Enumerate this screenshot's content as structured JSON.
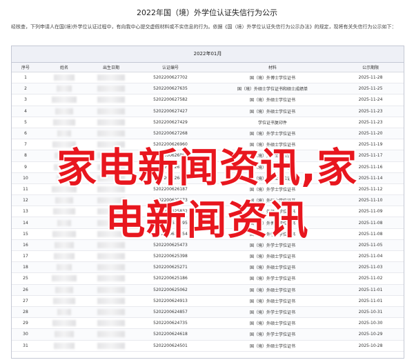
{
  "document": {
    "title": "2022年国（境）外学位认证失信行为公示",
    "intro": "经核查，下列申请人在国(境)外学位认证过程中，有向我中心提交虚假材料或不实信息的行为。依据《国（境）外学位认证失信行为公示办法》的规定，现将有关失信行为公示如下：",
    "table_caption": "2022年01月",
    "headers": [
      "序号",
      "姓名",
      "出生日期",
      "认证编号",
      "材料",
      "公示期限"
    ]
  },
  "rows": [
    {
      "seq": "1",
      "cert": "5202200627702",
      "material": "国（境）外博士学位证书",
      "deadline": "2025-11-28"
    },
    {
      "seq": "2",
      "cert": "5202200627635",
      "material": "国（境）外硕士学位证书和硕士成绩单",
      "deadline": "2025-11-25"
    },
    {
      "seq": "3",
      "cert": "5202200627582",
      "material": "国（境）外硕士学位证书",
      "deadline": "2025-11-24"
    },
    {
      "seq": "4",
      "cert": "5202200627427",
      "material": "国（境）外硕士学位证书",
      "deadline": "2025-11-23"
    },
    {
      "seq": "5",
      "cert": "5202200627429",
      "material": "学位证书复印件",
      "deadline": "2025-11-23"
    },
    {
      "seq": "6",
      "cert": "5202200627268",
      "material": "国（境）外学士学位证书",
      "deadline": "2025-11-20"
    },
    {
      "seq": "7",
      "cert": "5202200626960",
      "material": "国（境）外硕士学位证书",
      "deadline": "2025-11-19"
    },
    {
      "seq": "8",
      "cert": "5202200626883",
      "material": "国（境）外学士学位证书",
      "deadline": "2025-11-17"
    },
    {
      "seq": "9",
      "cert": "5202200626756",
      "material": "国（境）外硕士学位证书",
      "deadline": "2025-11-16"
    },
    {
      "seq": "10",
      "cert": "5202200626421",
      "material": "国（境）外硕士学位证书",
      "deadline": "2025-11-14"
    },
    {
      "seq": "11",
      "cert": "5202200626187",
      "material": "国（境）外学士学位证书",
      "deadline": "2025-11-12"
    },
    {
      "seq": "12",
      "cert": "5202200625973",
      "material": "国（境）外硕士学位证书",
      "deadline": "2025-11-10"
    },
    {
      "seq": "13",
      "cert": "5202200625832",
      "material": "国（境）外硕士学位证书",
      "deadline": "2025-11-09"
    },
    {
      "seq": "14",
      "cert": "5202200625695",
      "material": "国（境）外博士学位证书",
      "deadline": "2025-11-08"
    },
    {
      "seq": "15",
      "cert": "5202200625654",
      "material": "国（境）外学士学位证书",
      "deadline": "2025-11-08"
    },
    {
      "seq": "16",
      "cert": "5202200625473",
      "material": "国（境）外学士学位证书",
      "deadline": "2025-11-05"
    },
    {
      "seq": "17",
      "cert": "5202200625398",
      "material": "国（境）外硕士学位证书",
      "deadline": "2025-11-04"
    },
    {
      "seq": "18",
      "cert": "5202200625271",
      "material": "国（境）外硕士学位证书",
      "deadline": "2025-11-03"
    },
    {
      "seq": "25",
      "cert": "5202200625186",
      "material": "国（境）外学士学位证书",
      "deadline": "2025-11-02"
    },
    {
      "seq": "26",
      "cert": "5202200625062",
      "material": "国（境）外硕士学位证书",
      "deadline": "2025-11-01"
    },
    {
      "seq": "27",
      "cert": "5202200624913",
      "material": "国（境）外硕士学位证书",
      "deadline": "2025-11-01"
    },
    {
      "seq": "28",
      "cert": "5202200624857",
      "material": "国（境）外学士学位证书",
      "deadline": "2025-10-31"
    },
    {
      "seq": "29",
      "cert": "5202200624735",
      "material": "国（境）外硕士学位证书",
      "deadline": "2025-10-30"
    },
    {
      "seq": "30",
      "cert": "5202200624618",
      "material": "国（境）外学士学位证书",
      "deadline": "2025-10-29"
    },
    {
      "seq": "31",
      "cert": "5202200624501",
      "material": "国（境）外硕士学位证书",
      "deadline": "2025-10-28"
    }
  ],
  "overlay": {
    "line1": "家电新闻资讯,家",
    "line2": "电新闻资讯",
    "color": "#e8161e"
  }
}
